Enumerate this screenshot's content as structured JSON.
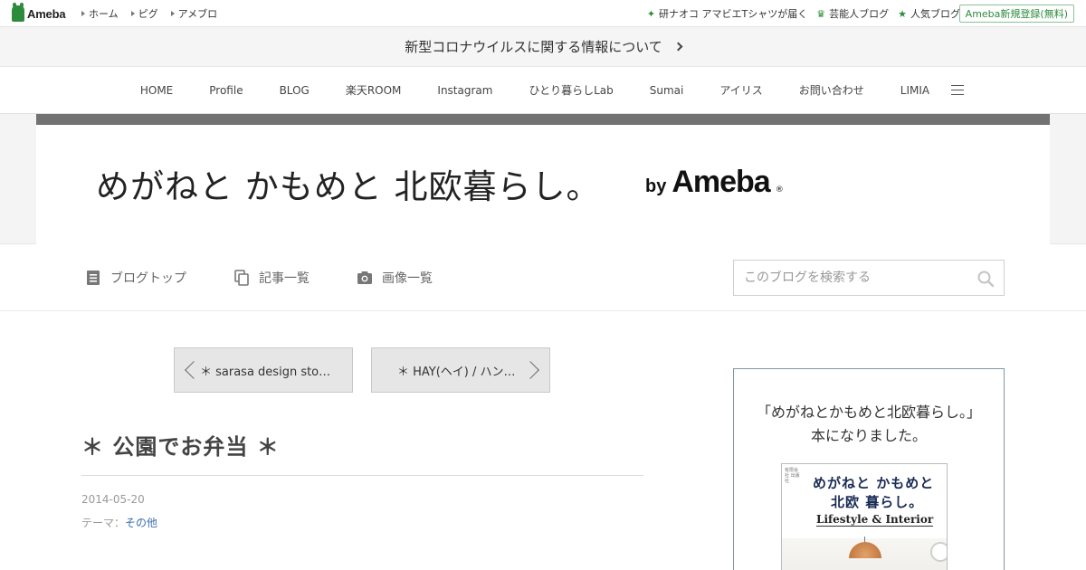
{
  "global_header": {
    "logo_text": "Ameba",
    "nav": [
      "ホーム",
      "ピグ",
      "アメブロ"
    ],
    "promos": [
      {
        "icon": "sparkle-icon",
        "label": "研ナオコ アマビエTシャツが届く"
      },
      {
        "icon": "crown-icon",
        "label": "芸能人ブログ"
      },
      {
        "icon": "star-icon",
        "label": "人気ブログ"
      }
    ],
    "register_label": "Ameba新規登録(無料)"
  },
  "notice": {
    "text": "新型コロナウイルスに関する情報について"
  },
  "blog_nav": {
    "items": [
      "HOME",
      "Profile",
      "BLOG",
      "楽天ROOM",
      "Instagram",
      "ひとり暮らしLab",
      "Sumai",
      "アイリス",
      "お問い合わせ",
      "LIMIA"
    ]
  },
  "banner": {
    "title": "めがねと かもめと 北欧暮らし。",
    "by": "by",
    "brand": "Ameba",
    "registered": "®"
  },
  "blog_menu": {
    "top_label": "ブログトップ",
    "entries_label": "記事一覧",
    "images_label": "画像一覧",
    "search_placeholder": "このブログを検索する"
  },
  "pager": {
    "prev_label": "＊ sarasa design sto…",
    "next_label": "＊ HAY(ヘイ) / ハン…"
  },
  "article": {
    "title": "＊ 公園でお弁当 ＊",
    "date": "2014-05-20",
    "theme_prefix": "テーマ：",
    "theme_link": "その他"
  },
  "sidebar": {
    "heading": "「めがねとかもめと北欧暮らし。」",
    "subheading": "本になりました。",
    "book": {
      "small_text": "有限会社 出版社",
      "line1": "めがねと かもめと",
      "line2": "北欧 暮らし。",
      "line3": "Lifestyle & Interior"
    }
  },
  "colors": {
    "ameba_green": "#2d8c3c",
    "banner_stripe": "#727272",
    "link_blue": "#3b6fb0",
    "sidebar_border": "#7e98a6"
  }
}
